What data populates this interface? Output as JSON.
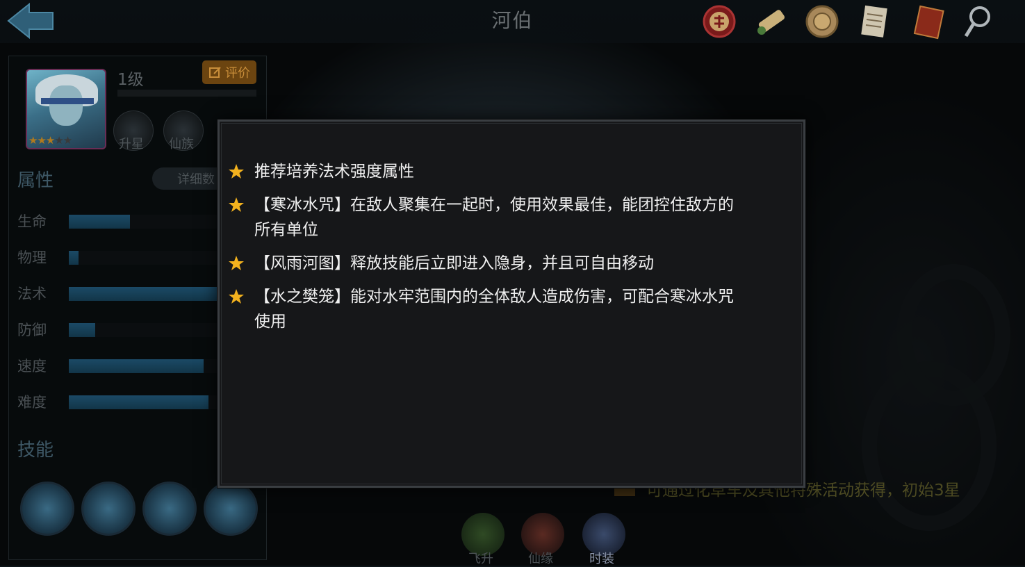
{
  "header": {
    "title": "河伯"
  },
  "hero": {
    "level": "1级",
    "rate_label": "评价",
    "stars_total": 5,
    "stars_filled": 3
  },
  "badges": [
    {
      "label": "升星"
    },
    {
      "label": "仙族"
    }
  ],
  "attributes": {
    "title": "属性",
    "detail_label": "详细数",
    "stats": [
      {
        "label": "生命",
        "fill": 0.39
      },
      {
        "label": "物理",
        "fill": 0.06
      },
      {
        "label": "法术",
        "fill": 1.0
      },
      {
        "label": "防御",
        "fill": 0.17
      },
      {
        "label": "速度",
        "fill": 0.86
      },
      {
        "label": "难度",
        "fill": 0.89
      }
    ]
  },
  "skills": {
    "title": "技能"
  },
  "source_note": "可通过化草车及其他特殊活动获得，初始3星",
  "bottom_tabs": [
    {
      "label": "飞升"
    },
    {
      "label": "仙缘"
    },
    {
      "label": "时装"
    }
  ],
  "tips": [
    "推荐培养法术强度属性",
    "【寒冰水咒】在敌人聚集在一起时，使用效果最佳，能团控住敌方的所有单位",
    "【风雨河图】释放技能后立即进入隐身，并且可自由移动",
    "【水之樊笼】能对水牢范围内的全体敌人造成伤害，可配合寒冰水咒使用"
  ],
  "colors": {
    "star": "#f3b21e",
    "stat_fill": "#1b4a66",
    "accent_orange": "#c98e3a"
  }
}
